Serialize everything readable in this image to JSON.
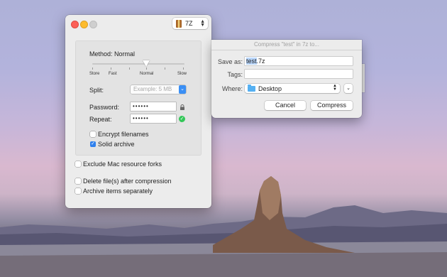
{
  "compressor": {
    "format_label": "7Z",
    "method_label": "Method: Normal",
    "slider_ticks": [
      "Store",
      "Fast",
      "Normal",
      "Slow"
    ],
    "split_label": "Split:",
    "split_placeholder": "Example: 5 MB",
    "password_label": "Password:",
    "password_value": "••••••",
    "repeat_label": "Repeat:",
    "repeat_value": "••••••",
    "encrypt_filenames_label": "Encrypt filenames",
    "solid_archive_label": "Solid archive",
    "exclude_forks_label": "Exclude Mac resource forks",
    "delete_after_label": "Delete file(s) after compression",
    "archive_separately_label": "Archive items separately"
  },
  "save_dialog": {
    "title": "Compress \"test\" in 7z to...",
    "save_as_label": "Save as:",
    "save_as_selected": "test",
    "save_as_ext": ".7z",
    "tags_label": "Tags:",
    "where_label": "Where:",
    "where_value": "Desktop",
    "cancel_label": "Cancel",
    "compress_label": "Compress"
  },
  "icons": {
    "lock": "lock-icon",
    "match": "checkmark-circle-icon",
    "folder": "folder-icon",
    "archive": "7z-archive-icon"
  },
  "colors": {
    "accent": "#2f80ed",
    "valid_green": "#34c759"
  }
}
